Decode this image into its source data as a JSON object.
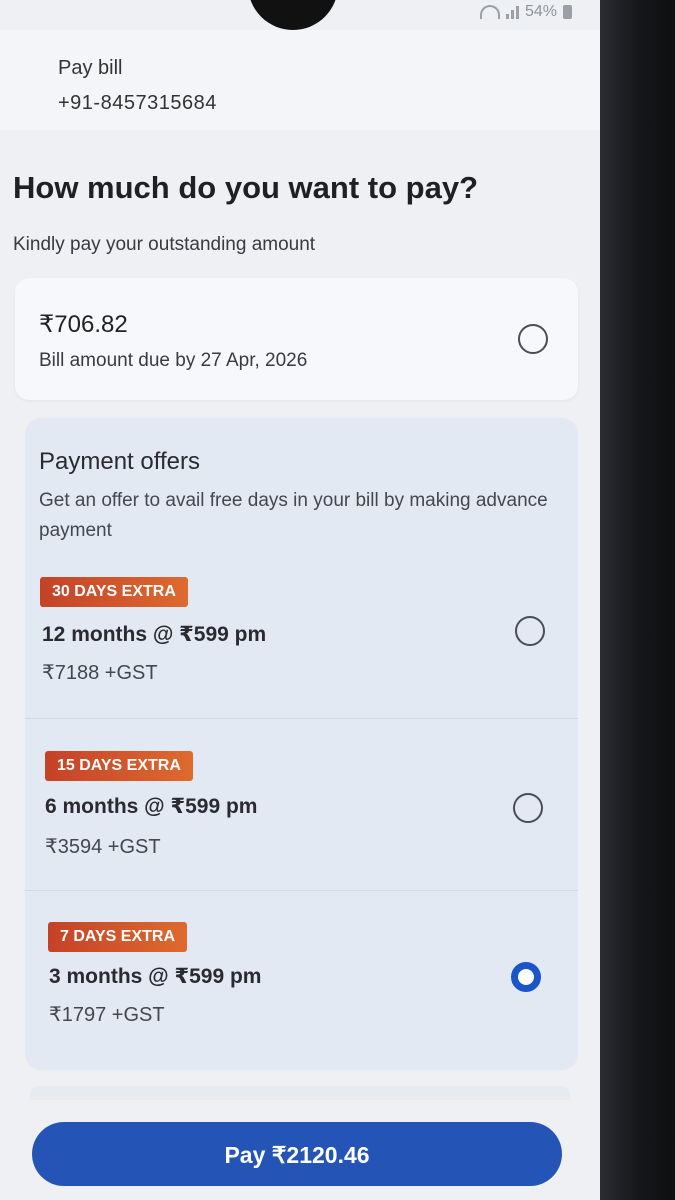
{
  "status_bar": {
    "battery": "54%"
  },
  "header": {
    "title": "Pay bill",
    "phone": "+91-8457315684"
  },
  "main": {
    "heading": "How much do you want to pay?",
    "subheading": "Kindly pay your outstanding amount",
    "due_card": {
      "amount": "₹706.82",
      "due_text": "Bill amount due by 27 Apr, 2026",
      "selected": false
    }
  },
  "offers": {
    "title": "Payment offers",
    "description": "Get an offer to avail free days in your bill by making advance payment",
    "items": [
      {
        "badge": "30 DAYS EXTRA",
        "plan": "12 months @ ₹599 pm",
        "price": "₹7188 +GST",
        "selected": false
      },
      {
        "badge": "15 DAYS EXTRA",
        "plan": "6 months @ ₹599 pm",
        "price": "₹3594 +GST",
        "selected": false
      },
      {
        "badge": "7 DAYS EXTRA",
        "plan": "3 months @ ₹599 pm",
        "price": "₹1797 +GST",
        "selected": true
      }
    ]
  },
  "pay_button": {
    "label": "Pay ₹2120.46"
  },
  "colors": {
    "accent": "#2455b6",
    "badge": "#d2502b",
    "radio_selected": "#1a56c8"
  }
}
